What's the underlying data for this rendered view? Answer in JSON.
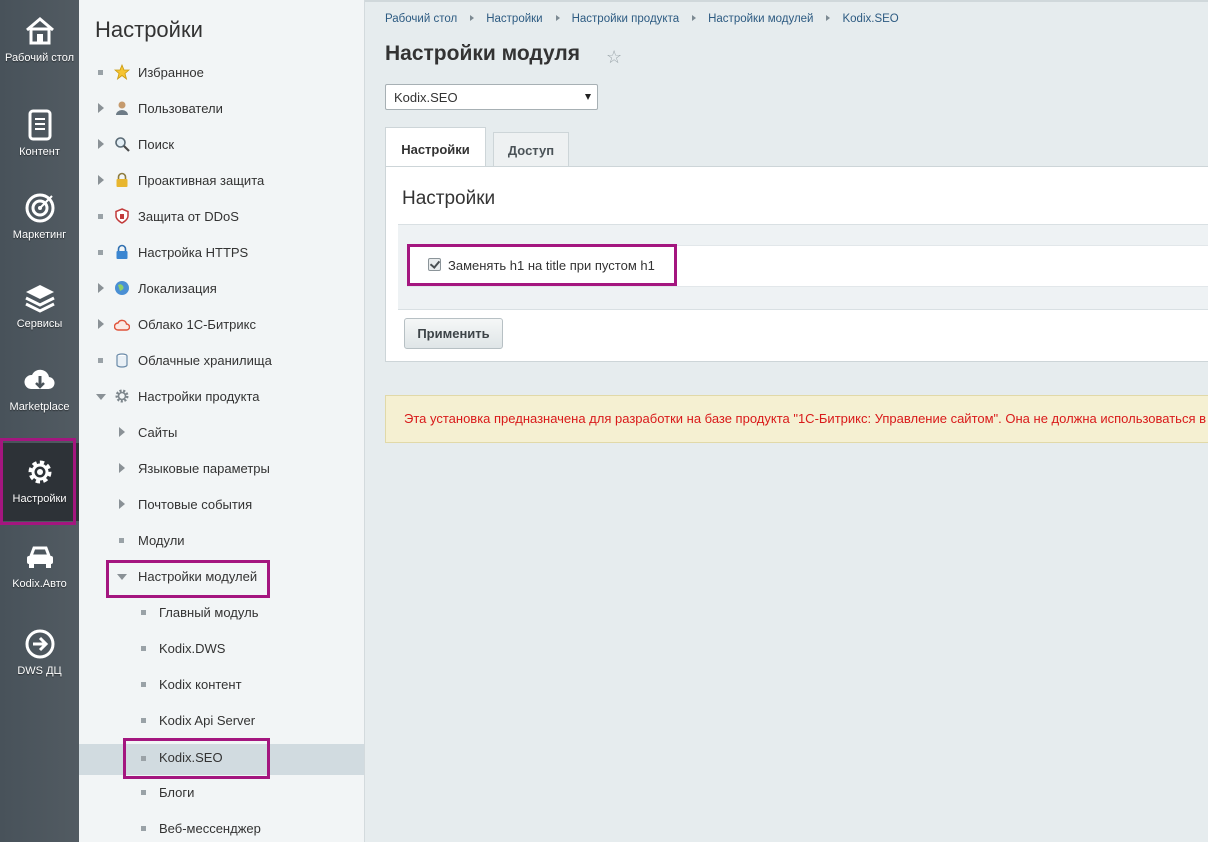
{
  "rail": {
    "items": [
      {
        "label": "Рабочий стол",
        "icon": "home-icon"
      },
      {
        "label": "Контент",
        "icon": "document-icon"
      },
      {
        "label": "Маркетинг",
        "icon": "target-icon"
      },
      {
        "label": "Сервисы",
        "icon": "layers-icon"
      },
      {
        "label": "Marketplace",
        "icon": "cloud-download-icon"
      },
      {
        "label": "Настройки",
        "icon": "gear-icon",
        "active": true
      },
      {
        "label": "Kodix.Авто",
        "icon": "car-icon"
      },
      {
        "label": "DWS ДЦ",
        "icon": "arrow-circle-icon"
      }
    ]
  },
  "tree": {
    "title": "Настройки",
    "items": [
      {
        "label": "Избранное",
        "icon": "star-icon",
        "marker": "dot"
      },
      {
        "label": "Пользователи",
        "icon": "user-icon",
        "marker": "arrow"
      },
      {
        "label": "Поиск",
        "icon": "magnifier-icon",
        "marker": "arrow"
      },
      {
        "label": "Проактивная защита",
        "icon": "lock-icon",
        "marker": "arrow"
      },
      {
        "label": "Защита от DDoS",
        "icon": "shield-icon",
        "marker": "dot"
      },
      {
        "label": "Настройка HTTPS",
        "icon": "padlock-icon",
        "marker": "dot"
      },
      {
        "label": "Локализация",
        "icon": "globe-icon",
        "marker": "arrow"
      },
      {
        "label": "Облако 1С-Битрикс",
        "icon": "cloud-icon",
        "marker": "arrow"
      },
      {
        "label": "Облачные хранилища",
        "icon": "storage-icon",
        "marker": "dot"
      },
      {
        "label": "Настройки продукта",
        "icon": "gear-icon",
        "marker": "arrow-down"
      },
      {
        "label": "Сайты",
        "marker": "arrow"
      },
      {
        "label": "Языковые параметры",
        "marker": "arrow"
      },
      {
        "label": "Почтовые события",
        "marker": "arrow"
      },
      {
        "label": "Модули",
        "marker": "dot"
      },
      {
        "label": "Настройки модулей",
        "marker": "arrow-down"
      },
      {
        "label": "Главный модуль",
        "marker": "dot"
      },
      {
        "label": "Kodix.DWS",
        "marker": "dot"
      },
      {
        "label": "Kodix контент",
        "marker": "dot"
      },
      {
        "label": "Kodix Api Server",
        "marker": "dot"
      },
      {
        "label": "Kodix.SEO",
        "marker": "dot",
        "selected": true
      },
      {
        "label": "Блоги",
        "marker": "dot"
      },
      {
        "label": "Веб-мессенджер",
        "marker": "dot"
      }
    ]
  },
  "breadcrumbs": [
    "Рабочий стол",
    "Настройки",
    "Настройки продукта",
    "Настройки модулей",
    "Kodix.SEO"
  ],
  "page_title": "Настройки модуля",
  "module_select": {
    "value": "Kodix.SEO"
  },
  "tabs": [
    {
      "label": "Настройки",
      "active": true
    },
    {
      "label": "Доступ",
      "active": false
    }
  ],
  "panel": {
    "title": "Настройки",
    "option_label": "Заменять h1 на title при пустом h1",
    "option_checked": true,
    "apply_label": "Применить"
  },
  "warning": "Эта установка предназначена для разработки на базе продукта \"1С-Битрикс: Управление сайтом\". Она не должна использоваться в",
  "colors": {
    "highlight": "#a4167f",
    "link": "#2d5b82",
    "warning_text": "#d91a1a",
    "warning_bg": "#f5f0d2"
  }
}
